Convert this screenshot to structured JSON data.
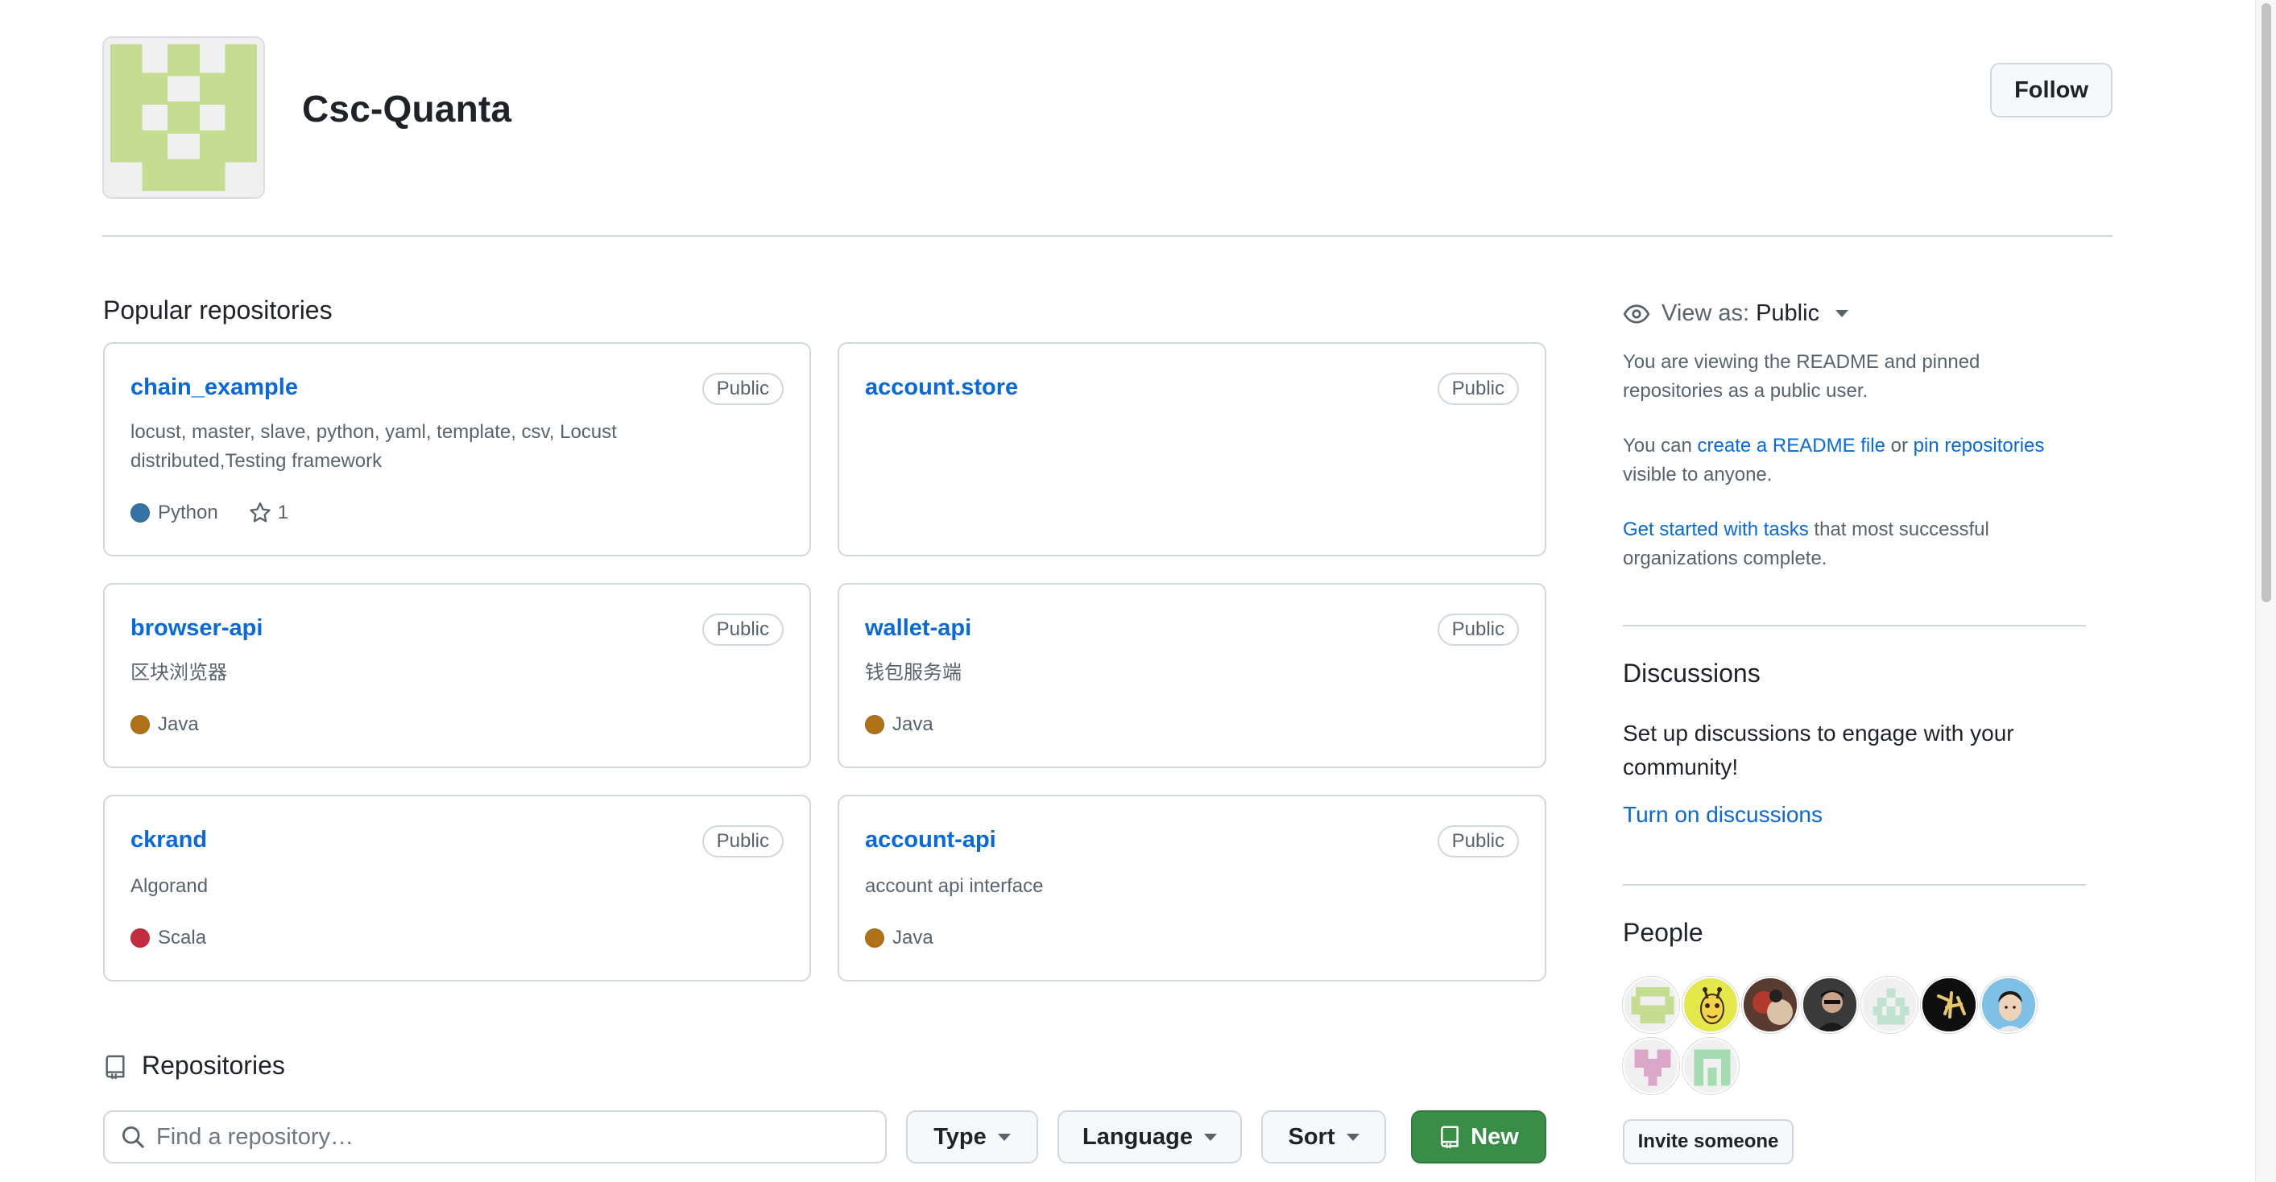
{
  "org": {
    "name": "Csc-Quanta",
    "avatar_color": "#c5dd91",
    "follow_label": "Follow"
  },
  "pinned": {
    "title": "Popular repositories",
    "repos": [
      {
        "name": "chain_example",
        "visibility": "Public",
        "description": "locust, master, slave, python, yaml, template, csv, Locust distributed,Testing framework",
        "language": "Python",
        "language_color": "#3572A5",
        "stars": "1"
      },
      {
        "name": "account.store",
        "visibility": "Public",
        "description": "",
        "language": "",
        "language_color": "",
        "stars": ""
      },
      {
        "name": "browser-api",
        "visibility": "Public",
        "description": "区块浏览器",
        "language": "Java",
        "language_color": "#b07219",
        "stars": ""
      },
      {
        "name": "wallet-api",
        "visibility": "Public",
        "description": "钱包服务端",
        "language": "Java",
        "language_color": "#b07219",
        "stars": ""
      },
      {
        "name": "ckrand",
        "visibility": "Public",
        "description": "Algorand",
        "language": "Scala",
        "language_color": "#c22d40",
        "stars": ""
      },
      {
        "name": "account-api",
        "visibility": "Public",
        "description": "account api interface",
        "language": "Java",
        "language_color": "#b07219",
        "stars": ""
      }
    ]
  },
  "repositories": {
    "title": "Repositories",
    "search_placeholder": "Find a repository…",
    "type_label": "Type",
    "language_label": "Language",
    "sort_label": "Sort",
    "new_label": "New"
  },
  "sidebar": {
    "view_as_prefix": "View as:",
    "view_as_value": "Public",
    "readme_info": "You are viewing the README and pinned repositories as a public user.",
    "can_prefix": "You can ",
    "create_readme_link": "create a README file",
    "or_text": " or ",
    "pin_repos_link": "pin repositories",
    "visible_suffix": " visible to anyone.",
    "get_started_link": "Get started with tasks",
    "get_started_suffix": " that most successful organizations complete.",
    "discussions_title": "Discussions",
    "discussions_text": "Set up discussions to engage with your community!",
    "turn_on_link": "Turn on discussions",
    "people_title": "People",
    "invite_label": "Invite someone"
  },
  "colors": {
    "link": "#0969da",
    "new_button": "#3a8d47",
    "border": "#d0d7de"
  }
}
